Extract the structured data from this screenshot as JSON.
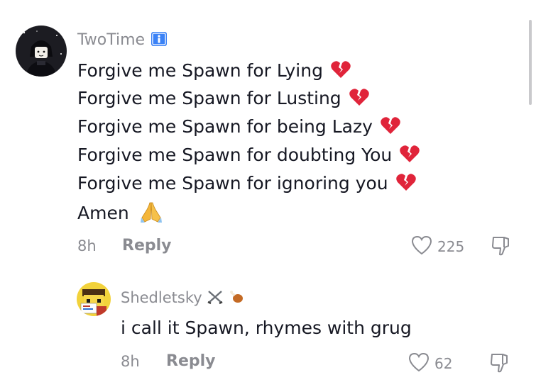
{
  "comments": [
    {
      "username": "TwoTime",
      "badge": "info-badge-icon",
      "lines": [
        "Forgive me Spawn for Lying",
        "Forgive me Spawn for Lusting",
        "Forgive me Spawn for being Lazy",
        "Forgive me Spawn for doubting You",
        "Forgive me Spawn for ignoring you",
        "Amen"
      ],
      "time": "8h",
      "reply_label": "Reply",
      "likes": "225"
    }
  ],
  "reply": {
    "username": "Shedletsky",
    "text": "i call it Spawn, rhymes with grug",
    "time": "8h",
    "reply_label": "Reply",
    "likes": "62"
  },
  "colors": {
    "text": "#161823",
    "muted": "#8a8b91",
    "broken_heart": "#e0243a",
    "badge_blue": "#3b82f6"
  }
}
